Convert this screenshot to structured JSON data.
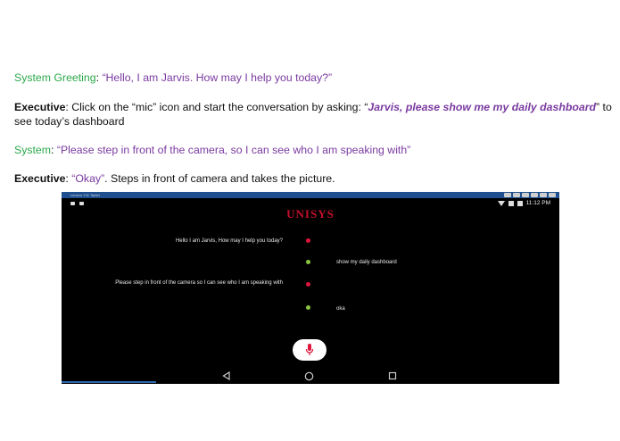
{
  "doc": {
    "line1": {
      "speaker": "System Greeting",
      "sep": ": ",
      "quote": "“Hello, I am Jarvis. How may I help you today?”"
    },
    "line2": {
      "speaker": "Executive",
      "before": ": Click on the “mic” icon and start the conversation by asking:  “",
      "italic_quote": "Jarvis, please show me my daily dashboard",
      "after": "” to see today’s dashboard"
    },
    "line3": {
      "speaker": "System",
      "sep": ": ",
      "quote": "“Please step in front of the camera, so I can see who I am speaking with”"
    },
    "line4": {
      "speaker": "Executive",
      "sep": ": ",
      "quote": "“Okay”",
      "rest": ". Steps in front of camera and takes the picture."
    }
  },
  "device": {
    "window_title": "Lenovo Y11 Tablet",
    "status_time": "11:12 PM",
    "logo": "UNISYS",
    "messages": [
      {
        "from": "system",
        "text": "Hello I am Jarvis, How may I help you today?",
        "dot_color": "#e0143c"
      },
      {
        "from": "user",
        "text": "show my daily dashboard",
        "dot_color": "#8bc53f"
      },
      {
        "from": "system",
        "text": "Please step in front of the camera so I can see who I am speaking with",
        "dot_color": "#e0143c"
      },
      {
        "from": "user",
        "text": "oka",
        "dot_color": "#8bc53f"
      }
    ],
    "icons": {
      "mic": "microphone-icon",
      "back": "back-triangle-icon",
      "home": "home-circle-icon",
      "recents": "recents-square-icon"
    }
  },
  "colors": {
    "speaker_green": "#2aa84a",
    "quote_purple": "#7a3aa0",
    "brand_red": "#c4102b",
    "mic_red": "#e0143c"
  }
}
